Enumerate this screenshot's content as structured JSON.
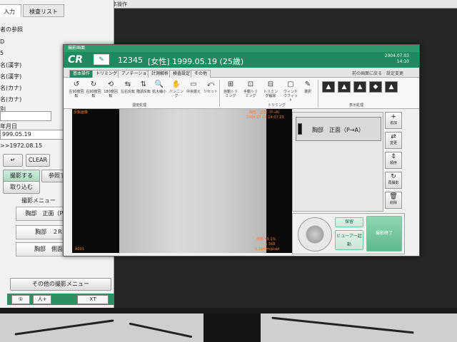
{
  "left_panel": {
    "tabs": [
      "入力",
      "検査リスト"
    ],
    "fields": [
      {
        "label": "者の参照",
        "value": ""
      },
      {
        "label": "D",
        "value": ""
      },
      {
        "label": "5",
        "value": ""
      },
      {
        "label": "名(漢字)",
        "value": ""
      },
      {
        "label": "名(漢字)",
        "value": ""
      },
      {
        "label": "名(カナ)",
        "value": ""
      },
      {
        "label": "名(カナ)",
        "value": ""
      },
      {
        "label": "別",
        "value": ""
      },
      {
        "label": "年月日",
        "value": "999.05.19"
      },
      {
        "label": "",
        "value": ">>1972.08.15"
      }
    ],
    "clear_label": "CLEAR",
    "mode_tabs": [
      "撮影する",
      "参照する"
    ],
    "import_label": "取り込む",
    "menu_title": "撮影メニュー",
    "menu_items": [
      "胸部　正面（P→A",
      "胸部　２R",
      "胸部　側面"
    ],
    "other_menu_label": "その他の撮影メニュー",
    "bottom_buttons": [
      "①",
      "人+",
      "XT"
    ]
  },
  "bg_window": {
    "title": "基本操作"
  },
  "dialog": {
    "window_title": "撮影画面",
    "logo": "CR",
    "patient_id": "12345",
    "patient_info": "[女性] 1999.05.19 (25歳)",
    "header_date": "2004.07.03",
    "header_time": "14:10",
    "tabs": [
      "基本操作",
      "トリミング",
      "アノテーション",
      "計測解析",
      "検査設定",
      "その他"
    ],
    "tab_right": "前の画面に戻る　設定変更",
    "tools": [
      {
        "icon": "↺",
        "label": "左90度回転"
      },
      {
        "icon": "↻",
        "label": "右90度回転"
      },
      {
        "icon": "⟲",
        "label": "180度回転"
      },
      {
        "icon": "⇆",
        "label": "左右反転"
      },
      {
        "icon": "⇅",
        "label": "階調反転"
      },
      {
        "icon": "🔍",
        "label": "拡大縮小"
      },
      {
        "icon": "✋",
        "label": "パンニング"
      },
      {
        "icon": "▭",
        "label": "中央揃え"
      },
      {
        "icon": "⤺",
        "label": "リセット"
      },
      {
        "icon": "⊞",
        "label": "自動トリミング"
      },
      {
        "icon": "⊡",
        "label": "手動トリミング"
      },
      {
        "icon": "⊟",
        "label": "トリミング解除"
      },
      {
        "icon": "▢",
        "label": "ウィンドウフィット"
      },
      {
        "icon": "✎",
        "label": "選択"
      }
    ],
    "tool_groups": [
      "濃度処理",
      "トリミング",
      "表示処理"
    ],
    "viewer": {
      "top_left": "反転画像",
      "top_right_1": "胸部　正面（P→A）",
      "top_right_2": "2004.07.03 14:07:23",
      "bottom_left": "A001",
      "bottom_right_1": "縮率 45.1%",
      "bottom_right_2": "S 368",
      "bottom_right_3": "0.15mm/pixel"
    },
    "exam_item": "胸部　正面（P→A）",
    "side_buttons": [
      {
        "icon": "+",
        "label": "追加"
      },
      {
        "icon": "⇄",
        "label": "変更"
      },
      {
        "icon": "⇕",
        "label": "順序"
      },
      {
        "icon": "↻",
        "label": "再撮影"
      },
      {
        "icon": "🗑",
        "label": "削除"
      }
    ],
    "hold_label": "保留",
    "viewer_label": "ビューアー起動",
    "finish_label": "撮影終了"
  }
}
